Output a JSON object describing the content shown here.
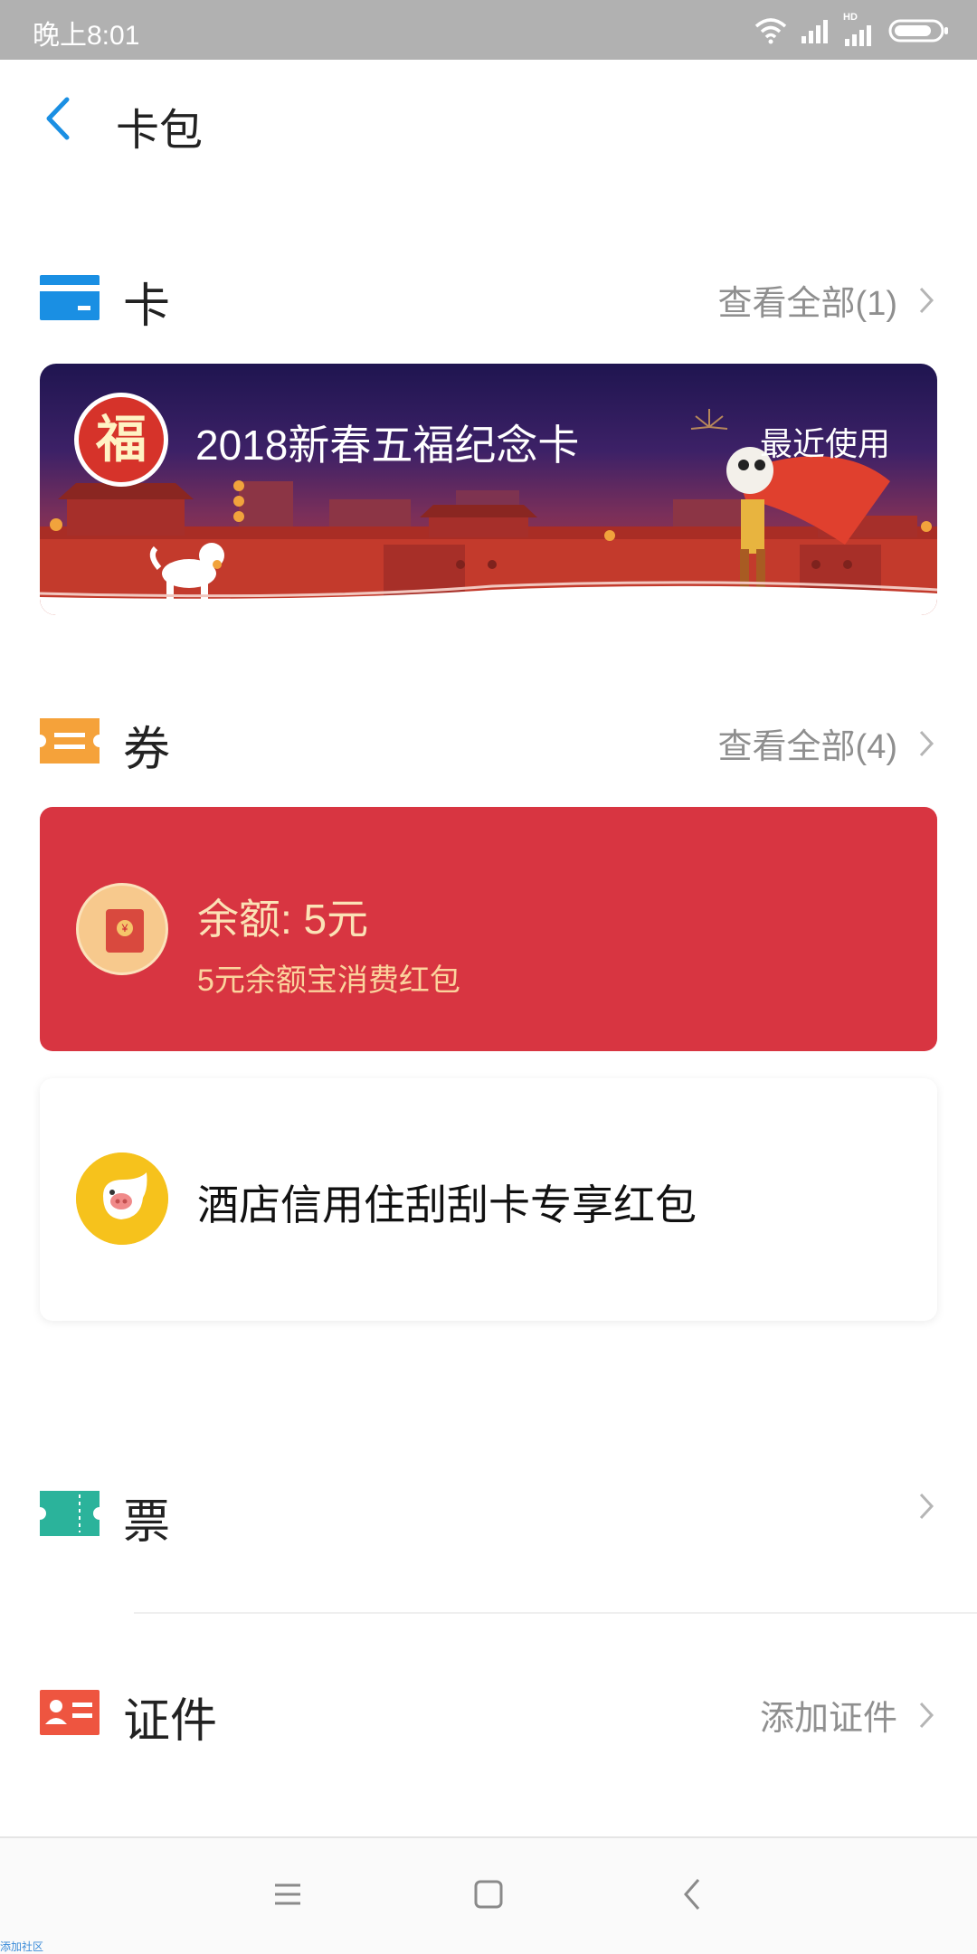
{
  "status_bar": {
    "time": "晚上8:01",
    "network_label": "HD"
  },
  "header": {
    "title": "卡包"
  },
  "sections": {
    "cards": {
      "title": "卡",
      "link": "查看全部(1)",
      "icon_color": "#1a8fe3"
    },
    "vouchers": {
      "title": "券",
      "link": "查看全部(4)",
      "icon_color": "#f5a23a"
    },
    "tickets": {
      "title": "票",
      "icon_color": "#2bb39b"
    },
    "ids": {
      "title": "证件",
      "link": "添加证件",
      "icon_color": "#ee5540"
    }
  },
  "card_item": {
    "badge_char": "福",
    "name": "2018新春五福纪念卡",
    "tag": "最近使用"
  },
  "voucher_red": {
    "amount": "余额: 5元",
    "description": "5元余额宝消费红包",
    "coin_symbol": "¥",
    "bg_color": "#d83541"
  },
  "voucher_white": {
    "title": "酒店信用住刮刮卡专享红包"
  },
  "watermark": "添加社区"
}
